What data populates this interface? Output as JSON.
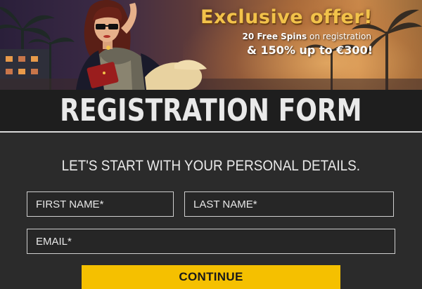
{
  "banner": {
    "offer_title": "Exclusive offer!",
    "offer_line1_bold": "20 Free Spins",
    "offer_line1_rest": " on registration",
    "offer_line2": "& 150% up to €300!"
  },
  "header": {
    "title": "REGISTRATION FORM"
  },
  "form": {
    "subtitle": "LET'S START WITH YOUR PERSONAL DETAILS.",
    "first_name_placeholder": "FIRST NAME*",
    "last_name_placeholder": "LAST NAME*",
    "email_placeholder": "EMAIL*",
    "continue_label": "CONTINUE"
  },
  "colors": {
    "accent": "#f5c000",
    "background": "#2b2b2b",
    "title_bar": "#1e1e1e",
    "offer_gold": "#f2c24a"
  }
}
